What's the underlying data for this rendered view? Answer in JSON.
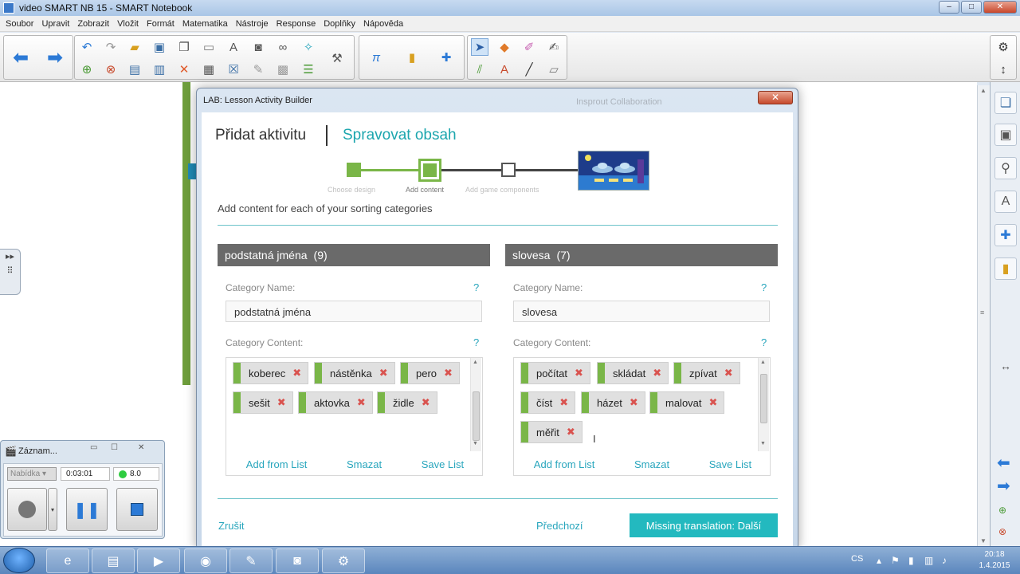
{
  "window": {
    "title": "video SMART NB 15 - SMART Notebook"
  },
  "menu": [
    "Soubor",
    "Upravit",
    "Zobrazit",
    "Vložit",
    "Formát",
    "Matematika",
    "Nástroje",
    "Response",
    "Doplňky",
    "Nápověda"
  ],
  "dialog": {
    "title": "LAB: Lesson Activity Builder",
    "ghost_text": "Insprout Collaboration",
    "tab_add": "Přidat aktivitu",
    "tab_manage": "Spravovat obsah",
    "steps": [
      "Choose design",
      "Add content",
      "Add game components"
    ],
    "instruction": "Add content for each of your sorting categories",
    "category_name_label": "Category Name:",
    "category_content_label": "Category Content:",
    "help": "?",
    "categories": [
      {
        "name": "podstatná jména",
        "count": "(9)",
        "input_value": "podstatná jména",
        "items": [
          "koberec",
          "nástěnka",
          "pero",
          "sešit",
          "aktovka",
          "židle"
        ]
      },
      {
        "name": "slovesa",
        "count": "(7)",
        "input_value": "slovesa",
        "items": [
          "počítat",
          "skládat",
          "zpívat",
          "číst",
          "házet",
          "malovat",
          "měřit"
        ]
      }
    ],
    "actions": {
      "add_from_list": "Add from List",
      "delete": "Smazat",
      "save_list": "Save List"
    },
    "footer": {
      "cancel": "Zrušit",
      "previous": "Předchozí",
      "next": "Missing translation: Další"
    }
  },
  "recorder": {
    "title": "Záznam...",
    "menu": "Nabídka",
    "time": "0:03:01",
    "level": "8.0"
  },
  "taskbar": {
    "lang": "CS",
    "time": "20:18",
    "date": "1.4.2015"
  },
  "colors": {
    "accent": "#23b9bf",
    "chip_green": "#7ab648",
    "header_gray": "#6a6a6a",
    "remove_red": "#d9534f"
  }
}
